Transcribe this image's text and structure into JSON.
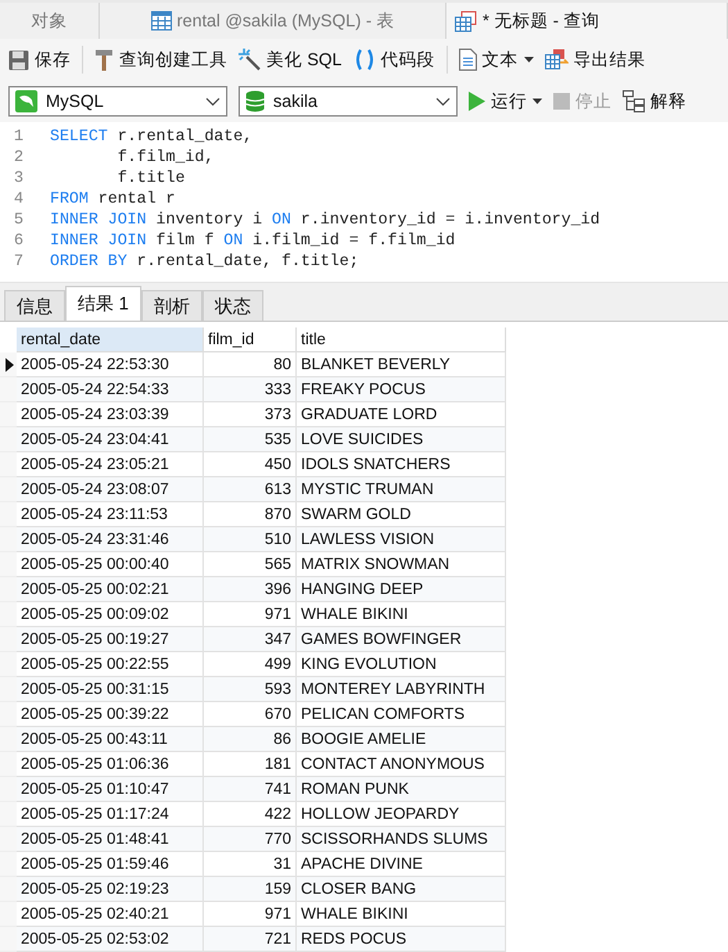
{
  "tabs": [
    {
      "label": "对象",
      "selected": false
    },
    {
      "label": "rental @sakila (MySQL) - 表",
      "selected": false
    },
    {
      "label": "* 无标题 - 查询",
      "selected": true
    }
  ],
  "toolbar": [
    {
      "label": "保存",
      "kind": "button"
    },
    {
      "kind": "separator"
    },
    {
      "label": "查询创建工具",
      "kind": "button"
    },
    {
      "label": "美化 SQL",
      "kind": "button"
    },
    {
      "label": "代码段",
      "kind": "button"
    },
    {
      "kind": "separator"
    },
    {
      "label": "文本",
      "kind": "dropdown"
    },
    {
      "label": "导出结果",
      "kind": "button"
    }
  ],
  "connection": {
    "value": "MySQL"
  },
  "database": {
    "value": "sakila"
  },
  "actions": [
    {
      "label": "运行",
      "kind": "dropdown",
      "disabled": false
    },
    {
      "label": "停止",
      "kind": "button",
      "disabled": true
    },
    {
      "label": "解释",
      "kind": "button",
      "disabled": false
    }
  ],
  "editor": {
    "lines": [
      {
        "number": "1",
        "tokens": [
          {
            "text": "SELECT",
            "kind": "keyword"
          },
          {
            "text": " r.rental_date,",
            "kind": "plain"
          }
        ]
      },
      {
        "number": "2",
        "tokens": [
          {
            "text": "       f.film_id,",
            "kind": "plain"
          }
        ]
      },
      {
        "number": "3",
        "tokens": [
          {
            "text": "       f.title",
            "kind": "plain"
          }
        ]
      },
      {
        "number": "4",
        "tokens": [
          {
            "text": "FROM",
            "kind": "keyword"
          },
          {
            "text": " rental r",
            "kind": "plain"
          }
        ]
      },
      {
        "number": "5",
        "tokens": [
          {
            "text": "INNER JOIN",
            "kind": "keyword"
          },
          {
            "text": " inventory i ",
            "kind": "plain"
          },
          {
            "text": "ON",
            "kind": "keyword"
          },
          {
            "text": " r.inventory_id = i.inventory_id",
            "kind": "plain"
          }
        ]
      },
      {
        "number": "6",
        "tokens": [
          {
            "text": "INNER JOIN",
            "kind": "keyword"
          },
          {
            "text": " film f ",
            "kind": "plain"
          },
          {
            "text": "ON",
            "kind": "keyword"
          },
          {
            "text": " i.film_id = f.film_id",
            "kind": "plain"
          }
        ]
      },
      {
        "number": "7",
        "tokens": [
          {
            "text": "ORDER BY",
            "kind": "keyword"
          },
          {
            "text": " r.rental_date, f.title;",
            "kind": "plain"
          }
        ]
      }
    ]
  },
  "result_tabs": [
    {
      "label": "信息",
      "selected": false
    },
    {
      "label": "结果 1",
      "selected": true
    },
    {
      "label": "剖析",
      "selected": false
    },
    {
      "label": "状态",
      "selected": false
    }
  ],
  "table": {
    "columns": [
      {
        "label": "rental_date",
        "selected": true
      },
      {
        "label": "film_id",
        "selected": false
      },
      {
        "label": "title",
        "selected": false
      }
    ],
    "rows": [
      {
        "current": true,
        "cells": [
          "2005-05-24 22:53:30",
          "80",
          "BLANKET BEVERLY"
        ]
      },
      {
        "current": false,
        "cells": [
          "2005-05-24 22:54:33",
          "333",
          "FREAKY POCUS"
        ]
      },
      {
        "current": false,
        "cells": [
          "2005-05-24 23:03:39",
          "373",
          "GRADUATE LORD"
        ]
      },
      {
        "current": false,
        "cells": [
          "2005-05-24 23:04:41",
          "535",
          "LOVE SUICIDES"
        ]
      },
      {
        "current": false,
        "cells": [
          "2005-05-24 23:05:21",
          "450",
          "IDOLS SNATCHERS"
        ]
      },
      {
        "current": false,
        "cells": [
          "2005-05-24 23:08:07",
          "613",
          "MYSTIC TRUMAN"
        ]
      },
      {
        "current": false,
        "cells": [
          "2005-05-24 23:11:53",
          "870",
          "SWARM GOLD"
        ]
      },
      {
        "current": false,
        "cells": [
          "2005-05-24 23:31:46",
          "510",
          "LAWLESS VISION"
        ]
      },
      {
        "current": false,
        "cells": [
          "2005-05-25 00:00:40",
          "565",
          "MATRIX SNOWMAN"
        ]
      },
      {
        "current": false,
        "cells": [
          "2005-05-25 00:02:21",
          "396",
          "HANGING DEEP"
        ]
      },
      {
        "current": false,
        "cells": [
          "2005-05-25 00:09:02",
          "971",
          "WHALE BIKINI"
        ]
      },
      {
        "current": false,
        "cells": [
          "2005-05-25 00:19:27",
          "347",
          "GAMES BOWFINGER"
        ]
      },
      {
        "current": false,
        "cells": [
          "2005-05-25 00:22:55",
          "499",
          "KING EVOLUTION"
        ]
      },
      {
        "current": false,
        "cells": [
          "2005-05-25 00:31:15",
          "593",
          "MONTEREY LABYRINTH"
        ]
      },
      {
        "current": false,
        "cells": [
          "2005-05-25 00:39:22",
          "670",
          "PELICAN COMFORTS"
        ]
      },
      {
        "current": false,
        "cells": [
          "2005-05-25 00:43:11",
          "86",
          "BOOGIE AMELIE"
        ]
      },
      {
        "current": false,
        "cells": [
          "2005-05-25 01:06:36",
          "181",
          "CONTACT ANONYMOUS"
        ]
      },
      {
        "current": false,
        "cells": [
          "2005-05-25 01:10:47",
          "741",
          "ROMAN PUNK"
        ]
      },
      {
        "current": false,
        "cells": [
          "2005-05-25 01:17:24",
          "422",
          "HOLLOW JEOPARDY"
        ]
      },
      {
        "current": false,
        "cells": [
          "2005-05-25 01:48:41",
          "770",
          "SCISSORHANDS SLUMS"
        ]
      },
      {
        "current": false,
        "cells": [
          "2005-05-25 01:59:46",
          "31",
          "APACHE DIVINE"
        ]
      },
      {
        "current": false,
        "cells": [
          "2005-05-25 02:19:23",
          "159",
          "CLOSER BANG"
        ]
      },
      {
        "current": false,
        "cells": [
          "2005-05-25 02:40:21",
          "971",
          "WHALE BIKINI"
        ]
      },
      {
        "current": false,
        "cells": [
          "2005-05-25 02:53:02",
          "721",
          "REDS POCUS"
        ]
      }
    ]
  }
}
